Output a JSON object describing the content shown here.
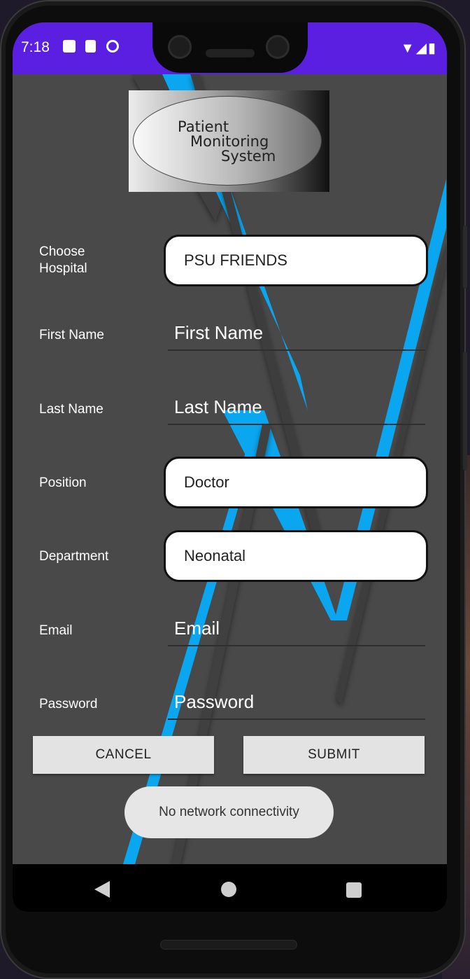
{
  "status_bar": {
    "time": "7:18",
    "left_icons": [
      "a-text-icon",
      "sd-card-icon",
      "data-saver-icon"
    ],
    "right_icons": [
      "wifi-icon",
      "signal-icon",
      "battery-icon"
    ]
  },
  "logo": {
    "lines": [
      "Patient",
      "Monitoring",
      "System"
    ]
  },
  "form": {
    "hospital": {
      "label_line1": "Choose",
      "label_line2": "Hospital",
      "value": "PSU FRIENDS"
    },
    "first_name": {
      "label": "First Name",
      "placeholder": "First Name"
    },
    "last_name": {
      "label": "Last Name",
      "placeholder": "Last Name"
    },
    "position": {
      "label": "Position",
      "value": "Doctor"
    },
    "department": {
      "label": "Department",
      "value": "Neonatal"
    },
    "email": {
      "label": "Email",
      "placeholder": "Email"
    },
    "password": {
      "label": "Password",
      "placeholder": "Password"
    }
  },
  "buttons": {
    "cancel": "CANCEL",
    "submit": "SUBMIT"
  },
  "toast": "No network connectivity",
  "nav": {
    "icons": [
      "back-icon",
      "home-icon",
      "recents-icon"
    ]
  },
  "colors": {
    "status_bar": "#5a1fe0",
    "accent_stripe": "#0aa6ef",
    "background": "#494949"
  }
}
